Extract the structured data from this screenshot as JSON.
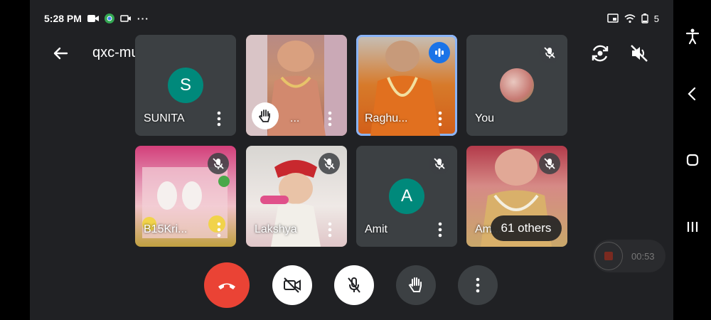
{
  "status": {
    "time": "5:28 PM",
    "battery": "5"
  },
  "meeting": {
    "code": "qxc-muhh-gox"
  },
  "tiles": [
    {
      "name": "SUNITA",
      "avatar": "S"
    },
    {
      "name": "..."
    },
    {
      "name": "Raghu..."
    },
    {
      "name": "You"
    },
    {
      "name": "B15Kri..."
    },
    {
      "name": "Lakshya"
    },
    {
      "name": "Amit",
      "avatar": "A"
    },
    {
      "name": "Am..."
    }
  ],
  "others_label": "61 others",
  "recording": {
    "time": "00:53"
  },
  "colors": {
    "end_call": "#ea4335",
    "active_outline": "#8ab4f8",
    "avatar": "#00897b"
  }
}
